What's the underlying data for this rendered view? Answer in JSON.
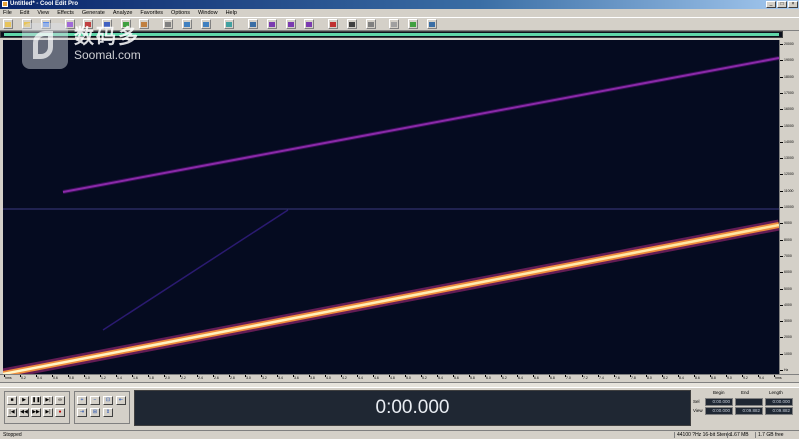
{
  "window": {
    "title": "Untitled* - Cool Edit Pro",
    "buttons": {
      "minimize": "_",
      "maximize": "□",
      "close": "×"
    }
  },
  "menu": [
    "File",
    "Edit",
    "View",
    "Effects",
    "Generate",
    "Analyze",
    "Favorites",
    "Options",
    "Window",
    "Help"
  ],
  "toolbar": {
    "icons": [
      "new-file-icon",
      "open-icon",
      "save-icon",
      "multitrack-icon",
      "cut-icon",
      "copy-icon",
      "paste-icon",
      "mix-paste-icon",
      "trim-icon",
      "undo-icon",
      "redo-icon",
      "repeat-icon",
      "waveform-view-icon",
      "spectral-view-icon",
      "spectral-pan-icon",
      "spectral-phase-icon",
      "record-mode-icon",
      "cursor-icon",
      "settings-icon",
      "cd-icon",
      "meter-icon",
      "help-icon"
    ]
  },
  "frequency_ruler": {
    "labels": [
      "20000",
      "19000",
      "18000",
      "17000",
      "16000",
      "15000",
      "14000",
      "13000",
      "12000",
      "11000",
      "10000",
      "9000",
      "8000",
      "7000",
      "6000",
      "5000",
      "4000",
      "3000",
      "2000",
      "1000",
      "Hz"
    ]
  },
  "time_ruler": {
    "labels": [
      "hms",
      "0.2",
      "0.4",
      "0.6",
      "0.8",
      "1.0",
      "1.2",
      "1.4",
      "1.6",
      "1.8",
      "2.0",
      "2.2",
      "2.4",
      "2.6",
      "2.8",
      "3.0",
      "3.2",
      "3.4",
      "3.6",
      "3.8",
      "4.0",
      "4.2",
      "4.4",
      "4.6",
      "4.8",
      "5.0",
      "5.2",
      "5.4",
      "5.6",
      "5.8",
      "6.0",
      "6.2",
      "6.4",
      "6.6",
      "6.8",
      "7.0",
      "7.2",
      "7.4",
      "7.6",
      "7.8",
      "8.0",
      "8.2",
      "8.4",
      "8.6",
      "8.8",
      "9.0",
      "9.2",
      "9.4",
      "hms"
    ]
  },
  "transport": {
    "buttons": [
      {
        "name": "stop-button",
        "glyph": "■"
      },
      {
        "name": "play-button",
        "glyph": "▶"
      },
      {
        "name": "pause-button",
        "glyph": "❚❚"
      },
      {
        "name": "play-to-end-button",
        "glyph": "▶|"
      },
      {
        "name": "loop-button",
        "glyph": "∞"
      },
      {
        "name": "go-to-start-button",
        "glyph": "|◀"
      },
      {
        "name": "rewind-button",
        "glyph": "◀◀"
      },
      {
        "name": "fast-forward-button",
        "glyph": "▶▶"
      },
      {
        "name": "go-to-end-button",
        "glyph": "▶|"
      },
      {
        "name": "record-button",
        "glyph": "●"
      }
    ]
  },
  "zoom": {
    "buttons": [
      {
        "name": "zoom-in-icon",
        "glyph": "+"
      },
      {
        "name": "zoom-out-icon",
        "glyph": "−"
      },
      {
        "name": "zoom-full-icon",
        "glyph": "⊡"
      },
      {
        "name": "zoom-left-icon",
        "glyph": "⇤"
      },
      {
        "name": "zoom-right-icon",
        "glyph": "⇥"
      },
      {
        "name": "zoom-selection-icon",
        "glyph": "⊞"
      },
      {
        "name": "zoom-in-vertical-icon",
        "glyph": "⇕"
      }
    ]
  },
  "time_display": "0:00.000",
  "selection": {
    "headers": [
      "Begin",
      "End",
      "Length"
    ],
    "rows": [
      {
        "label": "Sel",
        "values": [
          "0:00.000",
          "",
          "0:00.000"
        ]
      },
      {
        "label": "View",
        "values": [
          "0:00.000",
          "0:09.882",
          "0:09.882"
        ]
      }
    ]
  },
  "status": {
    "state": "Stopped",
    "format": "44100 ?Hz 16-bit Stereo",
    "size": "1.67 MB",
    "free": "1.7 GB free"
  },
  "colors": {
    "spectrogram_bg": "#050b20",
    "overview_range": "#5fd6a8",
    "time_display_bg": "#1f2733",
    "title_bar": "#0a246a"
  },
  "watermark": {
    "cn": "数码多",
    "en": "Soomal.com"
  }
}
